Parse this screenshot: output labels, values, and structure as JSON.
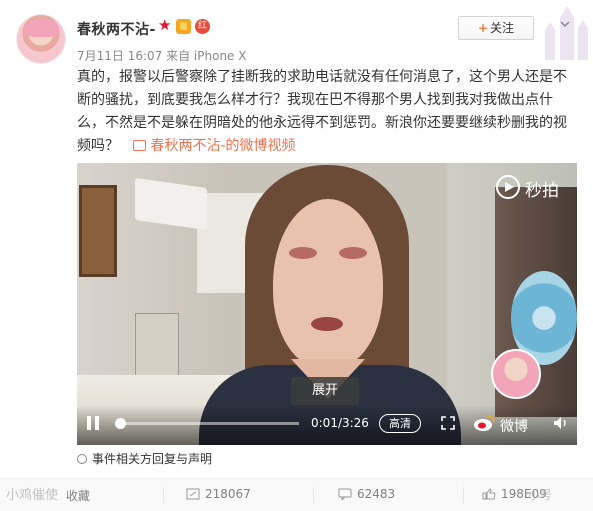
{
  "post": {
    "user_name": "春秋两不沾-",
    "badge_level": "红",
    "meta": "7月11日 16:07 来自 iPhone X",
    "follow_label": "关注",
    "text": "真的，报警以后警察除了挂断我的求助电话就没有任何消息了，这个男人还是不断的骚扰，到底要我怎么样才行？我现在巴不得那个男人找到我对我做出点什么，不然是不是躲在阴暗处的他永远得不到惩罚。新浪你还要要继续秒删我的视频吗？",
    "video_link": "春秋两不沾-的微博视频"
  },
  "video": {
    "brand": "秒拍",
    "expand_label": "展开",
    "time": "0:01/3:26",
    "progress": 0.005,
    "quality_label": "高清",
    "weibo_label": "微博"
  },
  "notice": "事件相关方回复与声明",
  "actions": {
    "favorite": "收藏",
    "share": "218067",
    "comment": "62483",
    "like": "198E09"
  },
  "watermark_left": "小鸡催使",
  "watermark_right": "小号",
  "colors": {
    "accent": "#eb7350",
    "star": "#e6162d"
  }
}
